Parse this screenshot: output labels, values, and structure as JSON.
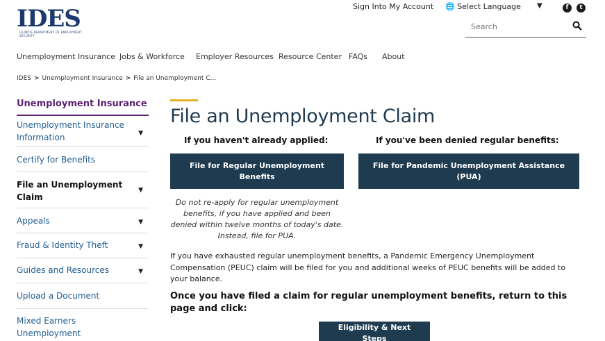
{
  "header": {
    "logo_text": "IDES",
    "logo_subtext": "ILLINOIS DEPARTMENT OF EMPLOYMENT SECURITY",
    "sign_in": "Sign Into My Account",
    "language": "Select Language",
    "search_placeholder": "Search",
    "social": [
      "facebook-icon",
      "twitter-icon"
    ]
  },
  "nav": {
    "items": [
      "Unemployment Insurance",
      "Jobs & Workforce",
      "Employer Resources",
      "Resource Center",
      "FAQs",
      "About"
    ]
  },
  "breadcrumb": {
    "items": [
      "IDES",
      "Unemployment Insurance",
      "File an Unemployment C..."
    ]
  },
  "sidebar": {
    "title": "Unemployment Insurance",
    "items": [
      {
        "label": "Unemployment Insurance Information",
        "has_submenu": true
      },
      {
        "label": "Certify for Benefits",
        "has_submenu": false
      },
      {
        "label": "File an Unemployment Claim",
        "has_submenu": true,
        "active": true
      },
      {
        "label": "Appeals",
        "has_submenu": true
      },
      {
        "label": "Fraud & Identity Theft",
        "has_submenu": true
      },
      {
        "label": "Guides and Resources",
        "has_submenu": true
      },
      {
        "label": "Upload a Document",
        "has_submenu": false
      },
      {
        "label": "Mixed Earners Unemployment Compensation (MEUC)",
        "has_submenu": false
      }
    ]
  },
  "main": {
    "title": "File an Unemployment Claim",
    "left_heading": "If you haven't already applied:",
    "right_heading": "If you've been denied regular benefits:",
    "regular_button": "File for Regular Unemployment Benefits",
    "pua_button": "File for Pandemic Unemployment Assistance (PUA)",
    "note": "Do not re-apply for regular unemployment benefits, if you have applied and been denied within twelve months of today's date. Instead, file for PUA.",
    "paragraph": "If you have exhausted regular unemployment benefits, a Pandemic Emergency Unemployment Compensation (PEUC) claim will be filed for you and additional weeks of PEUC benefits will be added to your balance.",
    "bold_paragraph": "Once you have filed a claim for regular unemployment benefits, return to this page and click:",
    "eligibility_button": "Eligibility & Next Steps"
  },
  "colors": {
    "brand_navy": "#1e3b4f",
    "sidebar_accent": "#5b1f72",
    "link_blue": "#1f5c8f",
    "title_accent": "#e5b020"
  }
}
